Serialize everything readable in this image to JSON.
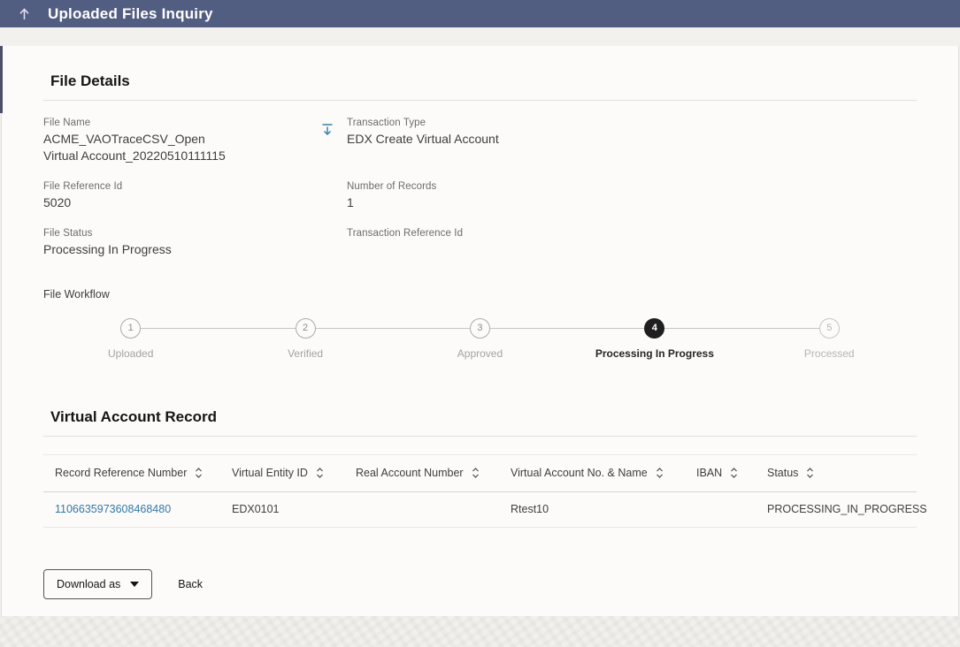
{
  "header": {
    "title": "Uploaded Files Inquiry"
  },
  "file_details": {
    "title": "File Details",
    "file_name": {
      "label": "File Name",
      "value": "ACME_VAOTraceCSV_Open Virtual Account_20220510111115"
    },
    "transaction_type": {
      "label": "Transaction Type",
      "value": "EDX Create Virtual Account"
    },
    "file_reference_id": {
      "label": "File Reference Id",
      "value": "5020"
    },
    "number_of_records": {
      "label": "Number of Records",
      "value": "1"
    },
    "file_status": {
      "label": "File Status",
      "value": "Processing In Progress"
    },
    "transaction_reference_id": {
      "label": "Transaction Reference Id",
      "value": ""
    },
    "workflow_label": "File Workflow",
    "workflow_steps": [
      {
        "number": "1",
        "label": "Uploaded",
        "state": "inactive"
      },
      {
        "number": "2",
        "label": "Verified",
        "state": "inactive"
      },
      {
        "number": "3",
        "label": "Approved",
        "state": "inactive"
      },
      {
        "number": "4",
        "label": "Processing In Progress",
        "state": "active"
      },
      {
        "number": "5",
        "label": "Processed",
        "state": "pending"
      }
    ]
  },
  "records": {
    "title": "Virtual Account Record",
    "columns": [
      "Record Reference Number",
      "Virtual Entity ID",
      "Real Account Number",
      "Virtual Account No. & Name",
      "IBAN",
      "Status"
    ],
    "rows": [
      {
        "record_reference_number": "1106635973608468480",
        "virtual_entity_id": "EDX0101",
        "real_account_number": "",
        "virtual_account_no_name": "Rtest10",
        "iban": "",
        "status": "PROCESSING_IN_PROGRESS"
      }
    ]
  },
  "actions": {
    "download_as": "Download as",
    "back": "Back"
  },
  "colors": {
    "header_bg": "#525d82",
    "link": "#3379a6",
    "active_step": "#1f1f1f",
    "accent_yellow": "#e9c94a",
    "download_icon": "#3d7fa8"
  }
}
